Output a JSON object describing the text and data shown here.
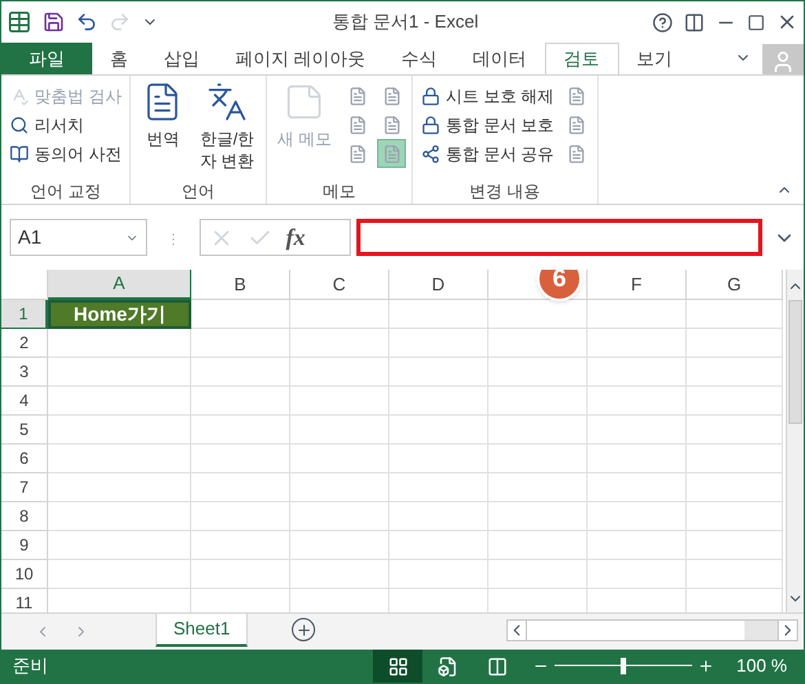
{
  "window": {
    "title": "통합 문서1 - Excel"
  },
  "tabs": [
    {
      "label": "파일",
      "kind": "file",
      "selected": false
    },
    {
      "label": "홈",
      "kind": "tab",
      "selected": false
    },
    {
      "label": "삽입",
      "kind": "tab",
      "selected": false
    },
    {
      "label": "페이지 레이아웃",
      "kind": "tab",
      "selected": false
    },
    {
      "label": "수식",
      "kind": "tab",
      "selected": false
    },
    {
      "label": "데이터",
      "kind": "tab",
      "selected": false
    },
    {
      "label": "검토",
      "kind": "tab",
      "selected": true
    },
    {
      "label": "보기",
      "kind": "tab",
      "selected": false
    }
  ],
  "ribbon": {
    "groups": [
      {
        "label": "언어 교정",
        "items": [
          {
            "kind": "small",
            "label": "맞춤법 검사",
            "disabled": true
          },
          {
            "kind": "small",
            "label": "리서치",
            "disabled": false
          },
          {
            "kind": "small",
            "label": "동의어 사전",
            "disabled": false
          }
        ]
      },
      {
        "label": "언어",
        "items": [
          {
            "kind": "large",
            "lines": [
              "번역"
            ],
            "disabled": false
          },
          {
            "kind": "large",
            "lines": [
              "한글/한",
              "자 변환"
            ],
            "disabled": false
          }
        ]
      },
      {
        "label": "메모",
        "items": [
          {
            "kind": "large",
            "lines": [
              "새 메모"
            ],
            "disabled": true
          },
          {
            "kind": "icons",
            "icons": [
              {
                "active": false
              },
              {
                "active": false
              },
              {
                "active": false
              },
              {
                "active": false
              },
              {
                "active": false
              },
              {
                "active": true
              }
            ]
          }
        ]
      },
      {
        "label": "변경 내용",
        "items": [
          {
            "kind": "small",
            "label": "시트 보호 해제",
            "disabled": false
          },
          {
            "kind": "small",
            "label": "통합 문서 보호",
            "disabled": false
          },
          {
            "kind": "small",
            "label": "통합 문서 공유",
            "disabled": false
          },
          {
            "kind": "icons",
            "icons": [
              {
                "active": false
              },
              {
                "active": false
              },
              {
                "active": false
              }
            ]
          }
        ]
      }
    ]
  },
  "formula_bar": {
    "name_box": "A1",
    "grip": "⋮",
    "function_label": "fx",
    "highlighted": true
  },
  "annotation": {
    "label": "6"
  },
  "grid": {
    "columns": [
      {
        "label": "A",
        "selected": true
      },
      {
        "label": "B",
        "selected": false
      },
      {
        "label": "C",
        "selected": false
      },
      {
        "label": "D",
        "selected": false
      },
      {
        "selected": false
      },
      {
        "label": "F",
        "selected": false
      },
      {
        "label": "G",
        "selected": false
      }
    ],
    "rows": [
      {
        "label": "1",
        "selected": true,
        "cells": [
          {
            "value": "Home가기",
            "selected": true
          }
        ]
      },
      {
        "label": "2",
        "selected": false
      },
      {
        "label": "3",
        "selected": false
      },
      {
        "label": "4",
        "selected": false
      },
      {
        "label": "5",
        "selected": false
      },
      {
        "label": "6",
        "selected": false
      },
      {
        "label": "7",
        "selected": false
      },
      {
        "label": "8",
        "selected": false
      },
      {
        "label": "9",
        "selected": false
      },
      {
        "label": "10",
        "selected": false
      },
      {
        "label": "11",
        "selected": false
      }
    ]
  },
  "sheet_tabs": [
    {
      "label": "Sheet1",
      "selected": true
    }
  ],
  "status_bar": {
    "status": "준비",
    "views": [
      {
        "kind": "normal",
        "selected": true
      },
      {
        "kind": "page-layout",
        "selected": false
      },
      {
        "kind": "page-break",
        "selected": false
      }
    ],
    "zoom": {
      "level": 0.5,
      "reading": "100 %"
    }
  }
}
